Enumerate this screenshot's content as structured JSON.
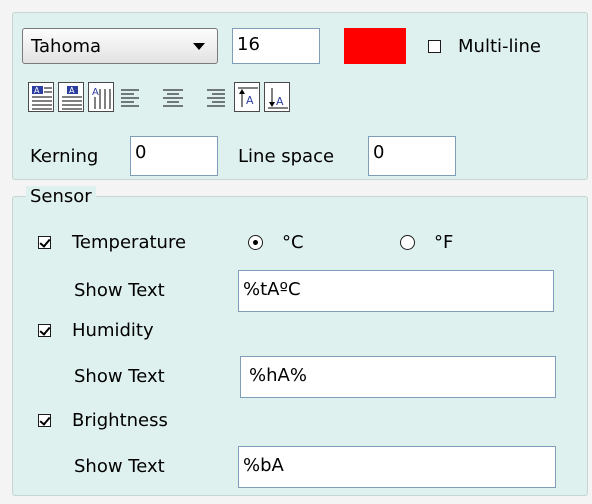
{
  "font": {
    "family_value": "Tahoma",
    "size_value": "16",
    "color": "#ff0000",
    "multiline_label": "Multi-line",
    "multiline_checked": false
  },
  "toolbar": {
    "buttons": [
      {
        "name": "align-top-left-icon"
      },
      {
        "name": "align-top-center-icon"
      },
      {
        "name": "vertical-text-icon"
      },
      {
        "name": "align-left-icon"
      },
      {
        "name": "align-center-icon"
      },
      {
        "name": "align-right-icon"
      },
      {
        "name": "valign-top-icon"
      },
      {
        "name": "valign-bottom-icon"
      }
    ]
  },
  "spacing": {
    "kerning_label": "Kerning",
    "kerning_value": "0",
    "line_space_label": "Line space",
    "line_space_value": "0"
  },
  "sensor": {
    "legend": "Sensor",
    "temperature": {
      "label": "Temperature",
      "checked": true
    },
    "units": {
      "celsius": "°C",
      "fahrenheit": "°F",
      "selected": "celsius"
    },
    "temperature_show_label": "Show Text",
    "temperature_text": "%tAºC",
    "humidity": {
      "label": "Humidity",
      "checked": true
    },
    "humidity_show_label": "Show Text",
    "humidity_text": "%hA%",
    "brightness": {
      "label": "Brightness",
      "checked": true
    },
    "brightness_show_label": "Show Text",
    "brightness_text": "%bA"
  }
}
